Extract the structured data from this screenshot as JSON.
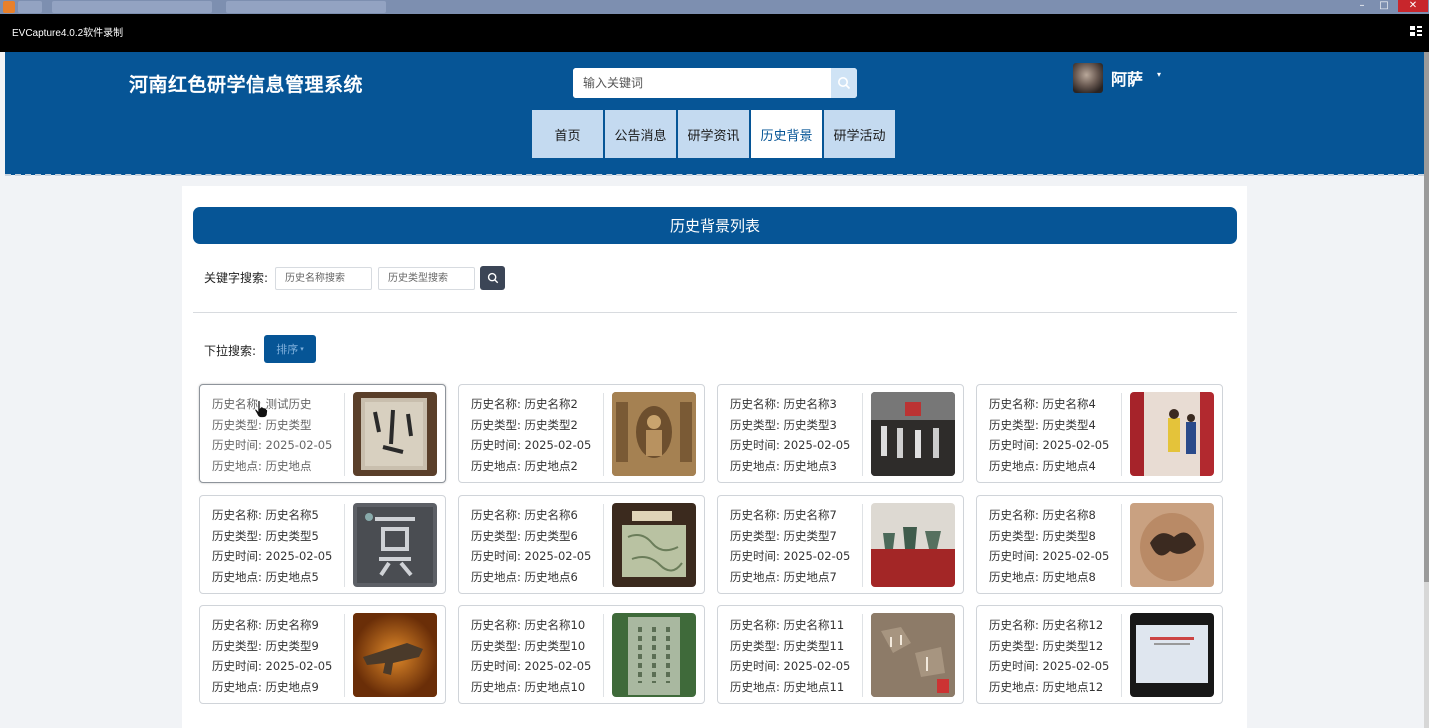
{
  "os": {
    "window_icon": "app-icon"
  },
  "capture_bar": {
    "title": "EVCapture4.0.2软件录制",
    "icon": "split-icon"
  },
  "header": {
    "site_title": "河南红色研学信息管理系统",
    "search_placeholder": "输入关键词",
    "user_name": "阿萨",
    "user_caret": "▾"
  },
  "nav": [
    {
      "label": "首页",
      "active": false
    },
    {
      "label": "公告消息",
      "active": false
    },
    {
      "label": "研学资讯",
      "active": false
    },
    {
      "label": "历史背景",
      "active": true
    },
    {
      "label": "研学活动",
      "active": false
    }
  ],
  "list": {
    "banner_title": "历史背景列表",
    "keyword_label": "关键字搜索:",
    "name_search_placeholder": "历史名称搜索",
    "type_search_placeholder": "历史类型搜索",
    "dropdown_label": "下拉搜索:",
    "sort_label": "排序",
    "sort_caret": "▾"
  },
  "cards": [
    {
      "name": "历史名称: 测试历史",
      "type": "历史类型: 历史类型",
      "time": "历史时间: 2025-02-05",
      "place": "历史地点: 历史地点",
      "image": "calligraphy"
    },
    {
      "name": "历史名称: 历史名称2",
      "type": "历史类型: 历史类型2",
      "time": "历史时间: 2025-02-05",
      "place": "历史地点: 历史地点2",
      "image": "buddha-grotto"
    },
    {
      "name": "历史名称: 历史名称3",
      "type": "历史类型: 历史类型3",
      "time": "历史时间: 2025-02-05",
      "place": "历史地点: 历史地点3",
      "image": "museum-hall"
    },
    {
      "name": "历史名称: 历史名称4",
      "type": "历史类型: 历史类型4",
      "time": "历史时间: 2025-02-05",
      "place": "历史地点: 历史地点4",
      "image": "visitors"
    },
    {
      "name": "历史名称: 历史名称5",
      "type": "历史类型: 历史类型5",
      "time": "历史时间: 2025-02-05",
      "place": "历史地点: 历史地点5",
      "image": "xia-character"
    },
    {
      "name": "历史名称: 历史名称6",
      "type": "历史类型: 历史类型6",
      "time": "历史时间: 2025-02-05",
      "place": "历史地点: 历史地点6",
      "image": "old-map"
    },
    {
      "name": "历史名称: 历史名称7",
      "type": "历史类型: 历史类型7",
      "time": "历史时间: 2025-02-05",
      "place": "历史地点: 历史地点7",
      "image": "bronze-vessels"
    },
    {
      "name": "历史名称: 历史名称8",
      "type": "历史类型: 历史类型8",
      "time": "历史时间: 2025-02-05",
      "place": "历史地点: 历史地点8",
      "image": "pottery"
    },
    {
      "name": "历史名称: 历史名称9",
      "type": "历史类型: 历史类型9",
      "time": "历史时间: 2025-02-05",
      "place": "历史地点: 历史地点9",
      "image": "bronze-artifact"
    },
    {
      "name": "历史名称: 历史名称10",
      "type": "历史类型: 历史类型10",
      "time": "历史时间: 2025-02-05",
      "place": "历史地点: 历史地点10",
      "image": "stone-stele"
    },
    {
      "name": "历史名称: 历史名称11",
      "type": "历史类型: 历史类型11",
      "time": "历史时间: 2025-02-05",
      "place": "历史地点: 历史地点11",
      "image": "rock-inscription"
    },
    {
      "name": "历史名称: 历史名称12",
      "type": "历史类型: 历史类型12",
      "time": "历史时间: 2025-02-05",
      "place": "历史地点: 历史地点12",
      "image": "screen-display"
    }
  ]
}
